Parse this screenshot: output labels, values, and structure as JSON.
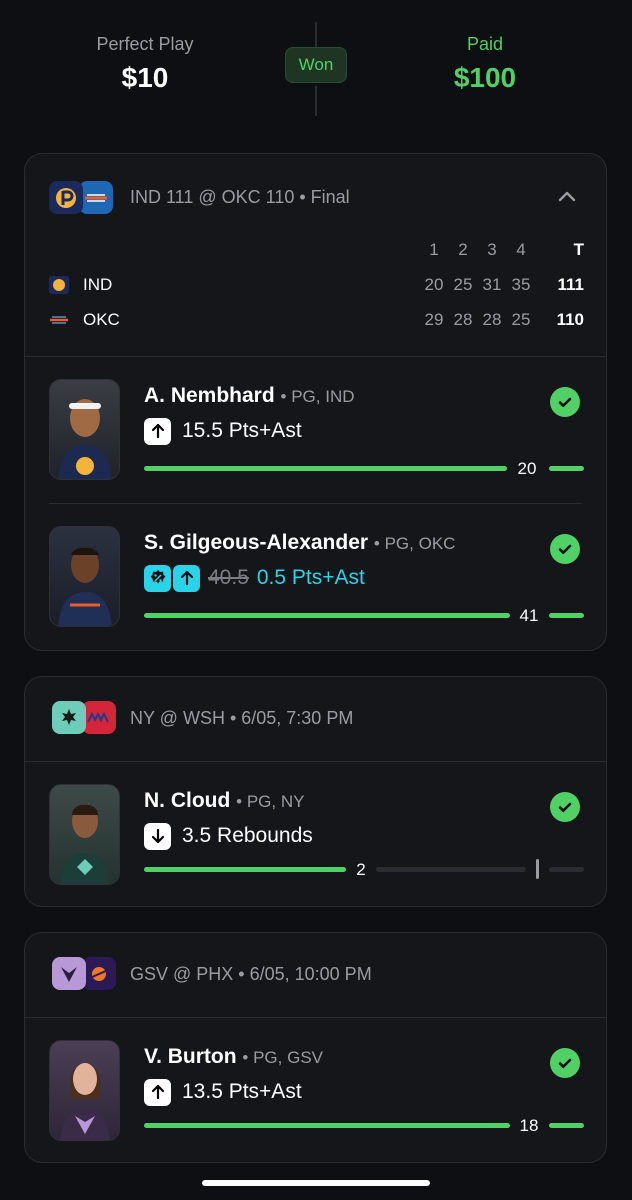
{
  "header": {
    "play_label": "Perfect Play",
    "play_amount": "$10",
    "status": "Won",
    "paid_label": "Paid",
    "paid_amount": "$100"
  },
  "games": [
    {
      "title": "IND 111 @ OKC 110 • Final",
      "logos": [
        "pacers-logo",
        "thunder-logo"
      ],
      "box_score": {
        "headers": [
          "1",
          "2",
          "3",
          "4",
          "T"
        ],
        "rows": [
          {
            "team": "IND",
            "quarters": [
              "20",
              "25",
              "31",
              "35"
            ],
            "total": "111"
          },
          {
            "team": "OKC",
            "quarters": [
              "29",
              "28",
              "28",
              "25"
            ],
            "total": "110"
          }
        ]
      },
      "picks": [
        {
          "name": "A. Nembhard",
          "meta": "• PG, IND",
          "direction": "up",
          "line": "15.5 Pts+Ast",
          "actual": "20",
          "progress": 1.0
        },
        {
          "name": "S. Gilgeous-Alexander",
          "meta": "• PG, OKC",
          "direction": "up",
          "promo": true,
          "original_line": "40.5",
          "line": "0.5 Pts+Ast",
          "actual": "41",
          "progress": 1.0
        }
      ]
    },
    {
      "title": "NY @ WSH • 6/05, 7:30 PM",
      "logos": [
        "liberty-logo",
        "mystics-logo"
      ],
      "picks": [
        {
          "name": "N. Cloud",
          "meta": "• PG, NY",
          "direction": "down",
          "line": "3.5 Rebounds",
          "actual": "2",
          "progress": 0.57
        }
      ]
    },
    {
      "title": "GSV @ PHX • 6/05, 10:00 PM",
      "logos": [
        "valkyries-logo",
        "mercury-logo"
      ],
      "picks": [
        {
          "name": "V. Burton",
          "meta": "• PG, GSV",
          "direction": "up",
          "line": "13.5 Pts+Ast",
          "actual": "18",
          "progress": 1.0
        }
      ]
    }
  ],
  "colors": {
    "accent_green": "#4fd166",
    "promo_cyan": "#29d3e8",
    "background": "#0e0f12",
    "card": "#15161a"
  }
}
